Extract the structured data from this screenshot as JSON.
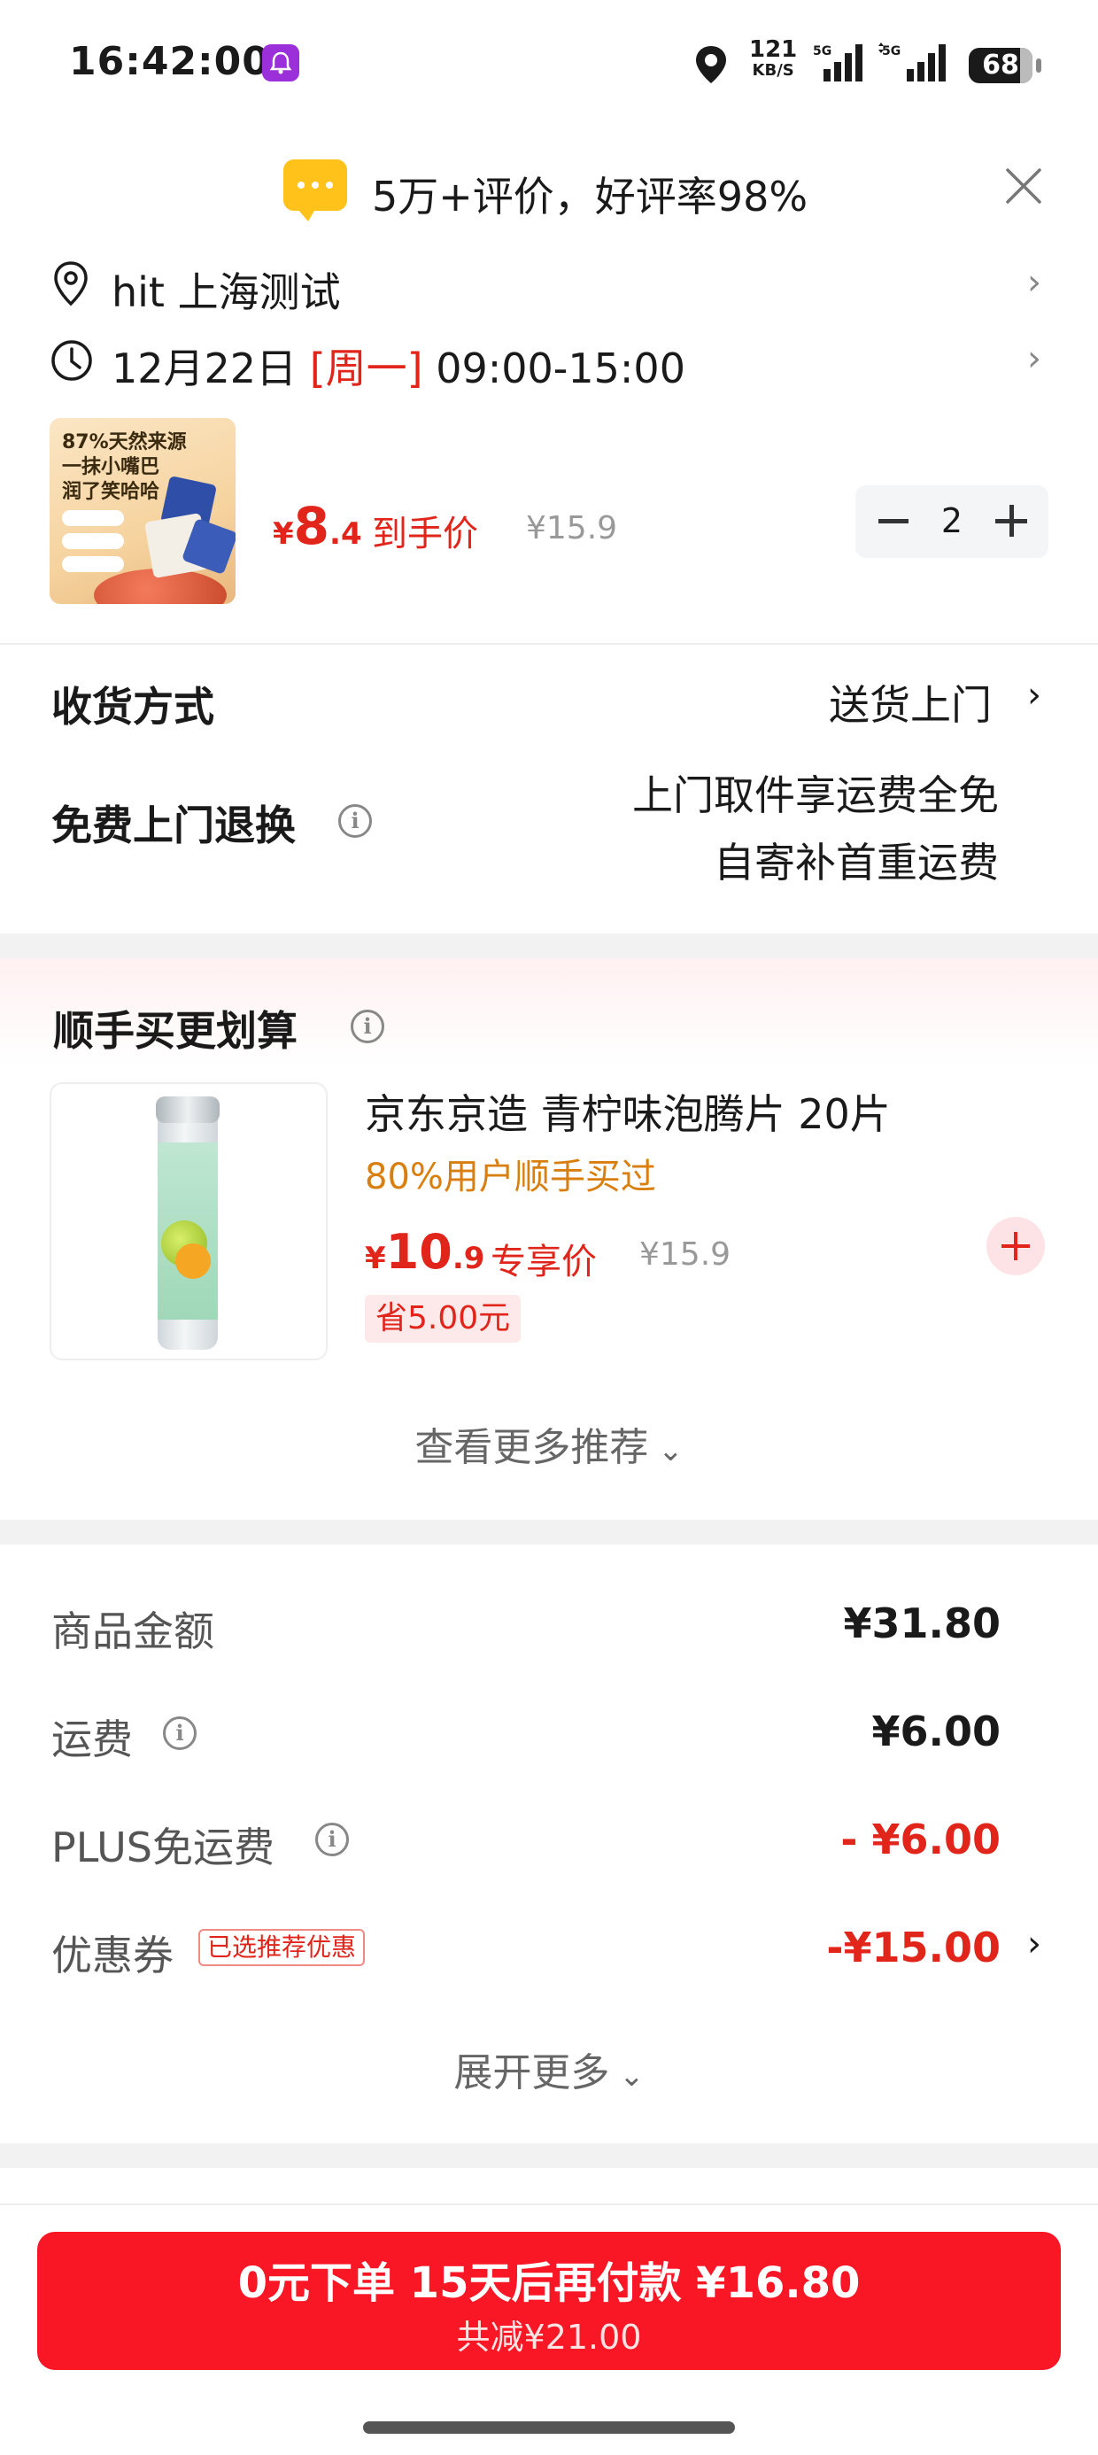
{
  "status_bar": {
    "time": "16:42:00",
    "net_speed": "121",
    "net_unit": "KB/S",
    "sig1_label": "5G",
    "sig2_label": "5G",
    "battery": "68"
  },
  "review_banner": {
    "text": "5万+评价，好评率98%"
  },
  "address": {
    "text": "hit  上海测试"
  },
  "delivery_time": {
    "date": "12月22日 ",
    "weekday": "[周一]",
    "range": " 09:00-15:00"
  },
  "product": {
    "image_lines": [
      "87%天然来源",
      "一抹小嘴巴",
      "润了笑哈哈"
    ],
    "price_currency": "¥",
    "price_int": "8",
    "price_dec": ".4",
    "price_label": "到手价",
    "original_price": "¥15.9",
    "quantity": "2"
  },
  "delivery_method": {
    "label": "收货方式",
    "value": "送货上门"
  },
  "free_return": {
    "label": "免费上门退换",
    "line1": "上门取件享运费全免",
    "line2": "自寄补首重运费"
  },
  "upsell": {
    "title": "顺手买更划算",
    "item": {
      "name": "京东京造 青柠味泡腾片 20片",
      "subtitle": "80%用户顺手买过",
      "price_currency": "¥",
      "price_int": "10",
      "price_dec": ".9",
      "price_label": "专享价",
      "original_price": "¥15.9",
      "save_text": "省5.00元"
    },
    "more_label": "查看更多推荐"
  },
  "summary": {
    "rows": [
      {
        "label": "商品金额",
        "value": "¥31.80"
      },
      {
        "label": "运费",
        "value": "¥6.00"
      },
      {
        "label": "PLUS免运费",
        "value": "- ¥6.00"
      },
      {
        "label": "优惠券",
        "value": "-¥15.00"
      }
    ],
    "coupon_tag": "已选推荐优惠",
    "expand_label": "展开更多"
  },
  "cta": {
    "line1": "0元下单 15天后再付款 ¥16.80",
    "line2": "共减¥21.00"
  },
  "colors": {
    "accent_red": "#e1251b",
    "cta_red": "#f91726",
    "orange": "#d97f10",
    "review_yellow": "#ffc21a"
  }
}
